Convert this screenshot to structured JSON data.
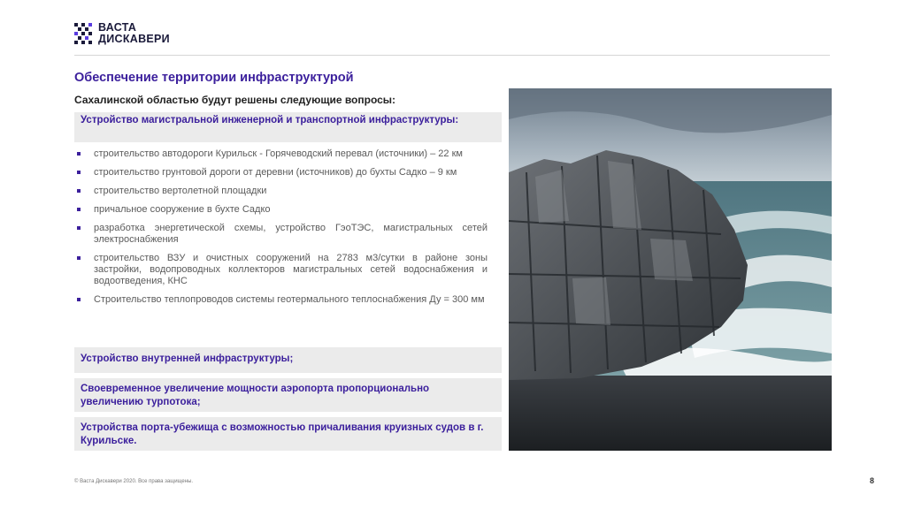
{
  "logo": {
    "line1": "ВАСТА",
    "line2": "ДИСКАВЕРИ"
  },
  "slide": {
    "title": "Обеспечение территории инфраструктурой",
    "intro": "Сахалинской областью будут решены следующие вопросы:",
    "box1": "Устройство магистральной инженерной и транспортной инфраструктуры:",
    "bullets": [
      "строительство автодороги Курильск - Горячеводский перевал (источники) – 22 км",
      "строительство грунтовой дороги от деревни (источников) до бухты Садко – 9 км",
      "строительство вертолетной площадки",
      "причальное сооружение в бухте Садко",
      "разработка энергетической схемы, устройство ГэоТЭС, магистральных сетей электроснабжения",
      "строительство ВЗУ и очистных сооружений на 2783 м3/сутки в районе зоны застройки, водопроводных коллекторов магистральных сетей водоснабжения и водоотведения, КНС",
      "Строительство теплопроводов системы геотермального теплоснабжения Ду = 300 мм"
    ],
    "box2": "Устройство внутренней инфраструктуры;",
    "box3": "Своевременное увеличение мощности аэропорта пропорционально увеличению турпотока;",
    "box4": "Устройства порта-убежища с возможностью причаливания круизных судов в г. Курильске."
  },
  "footer": {
    "copyright": "© Васта Дискавери 2020. Все права защищены.",
    "page": "8"
  },
  "colors": {
    "accent": "#3b1f9c",
    "box_bg": "#ebebeb",
    "rule": "#d6d6d6"
  },
  "icons": {
    "logo": "pixel-grid-logo-icon",
    "bullet": "square-bullet-icon"
  }
}
